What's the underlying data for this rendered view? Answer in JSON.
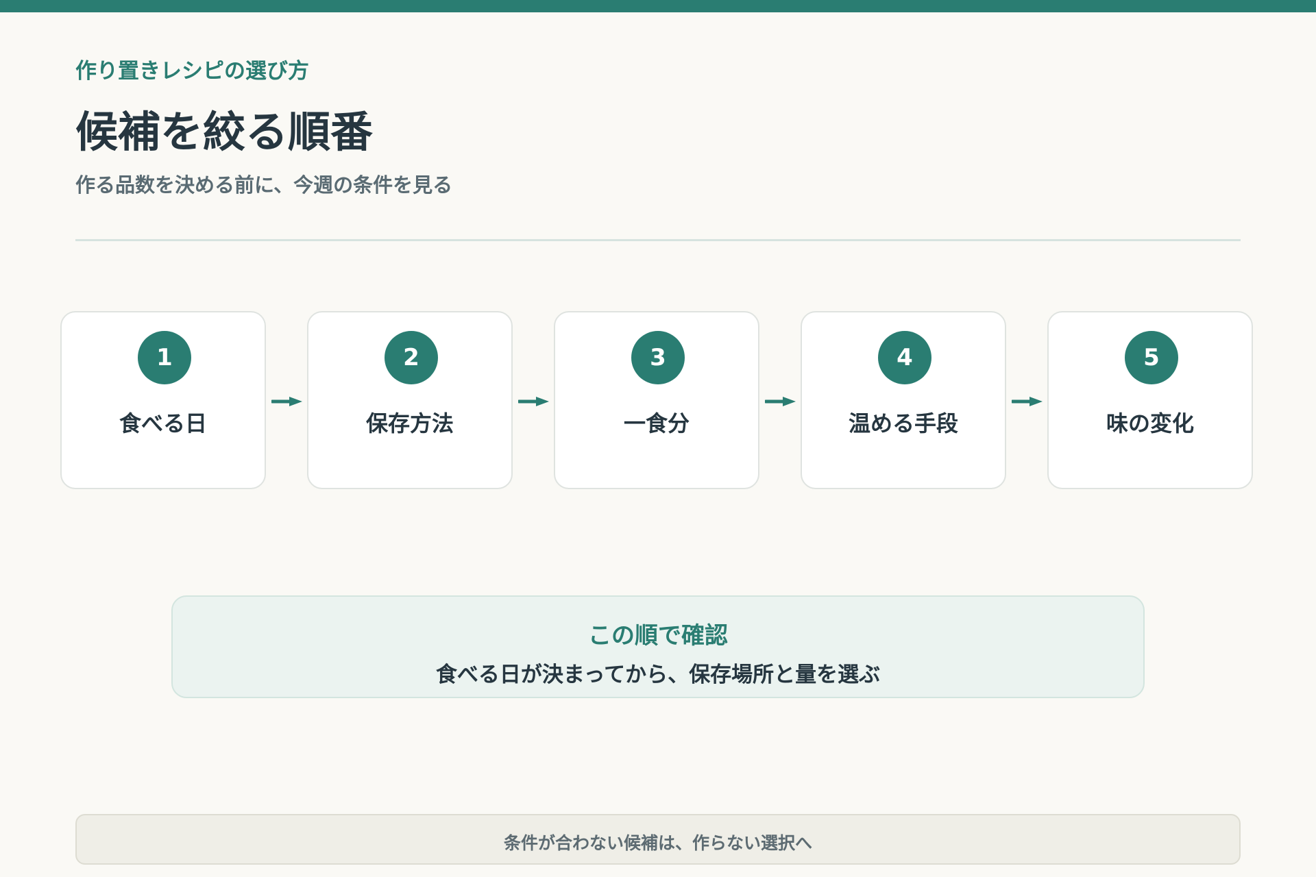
{
  "accent_color": "#2a7d72",
  "header": {
    "eyebrow": "作り置きレシピの選び方",
    "title": "候補を絞る順番",
    "subtitle": "作る品数を決める前に、今週の条件を見る"
  },
  "steps": [
    {
      "number": "1",
      "label": "食べる日"
    },
    {
      "number": "2",
      "label": "保存方法"
    },
    {
      "number": "3",
      "label": "一食分"
    },
    {
      "number": "4",
      "label": "温める手段"
    },
    {
      "number": "5",
      "label": "味の変化"
    }
  ],
  "note": {
    "title": "この順で確認",
    "body": "食べる日が決まってから、保存場所と量を選ぶ"
  },
  "footer": {
    "text": "条件が合わない候補は、作らない選択へ"
  }
}
